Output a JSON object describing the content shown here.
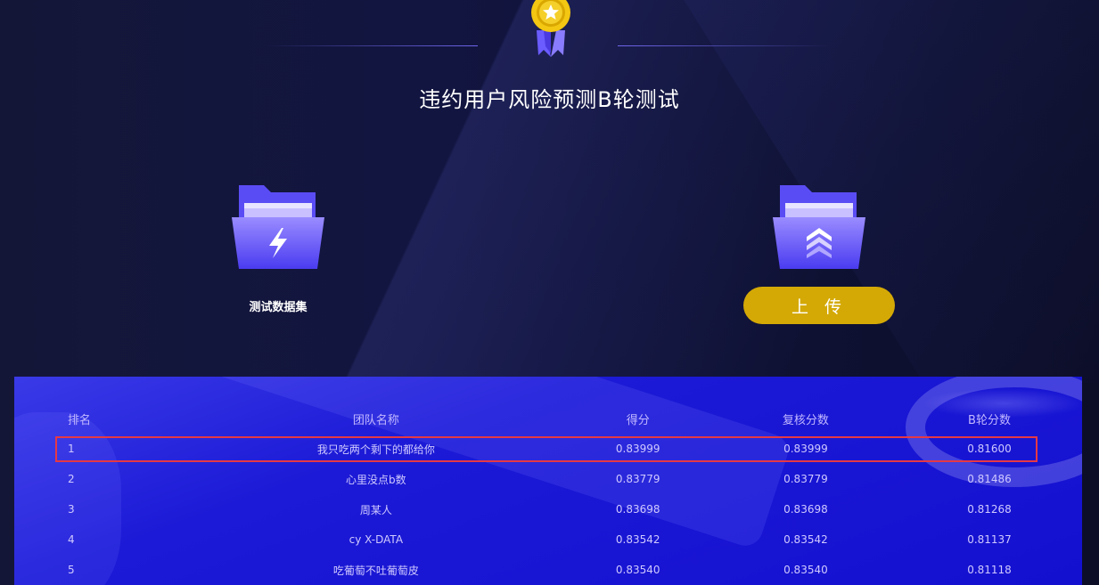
{
  "header": {
    "title": "违约用户风险预测B轮测试"
  },
  "actions": {
    "dataset_label": "测试数据集",
    "upload_label": "上 传"
  },
  "colors": {
    "accent_gold": "#d4a906",
    "table_bg": "#1410d0",
    "highlight": "#e53945"
  },
  "leaderboard": {
    "columns": [
      "排名",
      "团队名称",
      "得分",
      "复核分数",
      "B轮分数"
    ],
    "rows": [
      {
        "rank": "1",
        "team": "我只吃两个剩下的都给你",
        "score": "0.83999",
        "review": "0.83999",
        "b": "0.81600"
      },
      {
        "rank": "2",
        "team": "心里没点b数",
        "score": "0.83779",
        "review": "0.83779",
        "b": "0.81486"
      },
      {
        "rank": "3",
        "team": "周某人",
        "score": "0.83698",
        "review": "0.83698",
        "b": "0.81268"
      },
      {
        "rank": "4",
        "team": "cy X-DATA",
        "score": "0.83542",
        "review": "0.83542",
        "b": "0.81137"
      },
      {
        "rank": "5",
        "team": "吃葡萄不吐葡萄皮",
        "score": "0.83540",
        "review": "0.83540",
        "b": "0.81118"
      }
    ]
  }
}
